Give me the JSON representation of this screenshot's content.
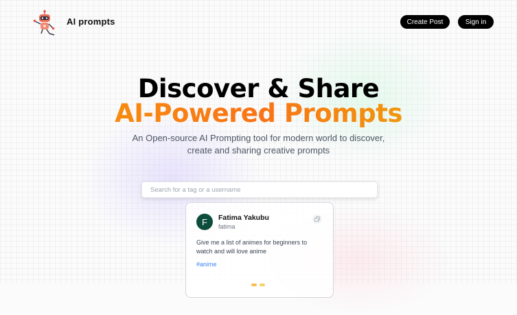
{
  "nav": {
    "brand": "AI prompts",
    "logo_icon": "robot-icon",
    "create_post_label": "Create Post",
    "sign_in_label": "Sign in"
  },
  "hero": {
    "title_line1": "Discover & Share",
    "title_line2": "AI-Powered Prompts",
    "description": "An Open-source AI Prompting tool for modern world to discover, create and sharing creative prompts"
  },
  "search": {
    "placeholder": "Search for a tag or a username",
    "value": ""
  },
  "posts": [
    {
      "avatar_initial": "F",
      "name": "Fatima Yakubu",
      "handle": "fatima",
      "prompt": "Give me a list of animes for beginners to watch and will love anime",
      "tag": "#anime"
    }
  ],
  "colors": {
    "gradient_start": "#f59e0b",
    "gradient_mid": "#f97316",
    "gradient_end": "#eab308",
    "avatar_bg": "#0d4d3b",
    "tag": "#3b82f6",
    "button_bg": "#000000"
  }
}
